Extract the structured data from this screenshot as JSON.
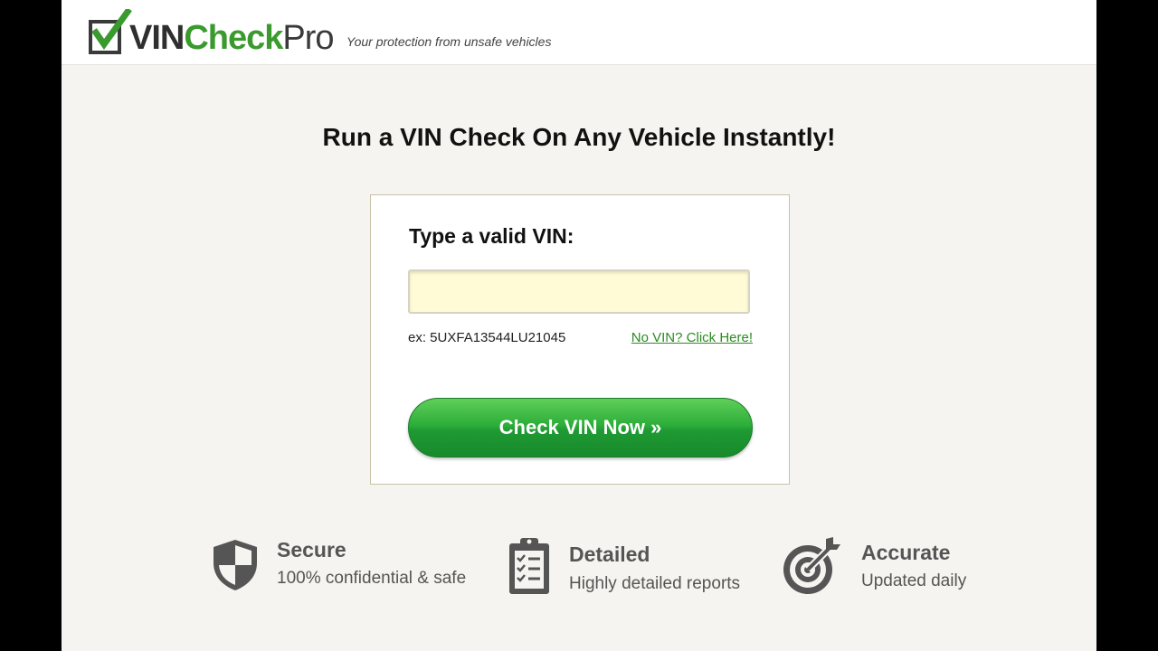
{
  "header": {
    "logo": {
      "part1": "VIN",
      "part2": "Check",
      "part3": "Pro"
    },
    "tagline": "Your protection from unsafe vehicles"
  },
  "main": {
    "headline": "Run a VIN Check On Any Vehicle Instantly!"
  },
  "vin_form": {
    "label": "Type a valid VIN:",
    "input_value": "",
    "input_placeholder": "",
    "example": "ex: 5UXFA13544LU21045",
    "no_vin_link": "No VIN? Click Here!",
    "submit_label": "Check VIN Now »"
  },
  "features": [
    {
      "icon": "shield-icon",
      "title": "Secure",
      "subtitle": "100% confidential & safe"
    },
    {
      "icon": "clipboard-checklist-icon",
      "title": "Detailed",
      "subtitle": "Highly detailed reports"
    },
    {
      "icon": "target-icon",
      "title": "Accurate",
      "subtitle": "Updated daily"
    }
  ],
  "colors": {
    "brand_green": "#3a9a2e",
    "button_green": "#2eae3a",
    "input_bg": "#fffbd6",
    "page_bg": "#f5f4f0",
    "icon_gray": "#555555"
  }
}
